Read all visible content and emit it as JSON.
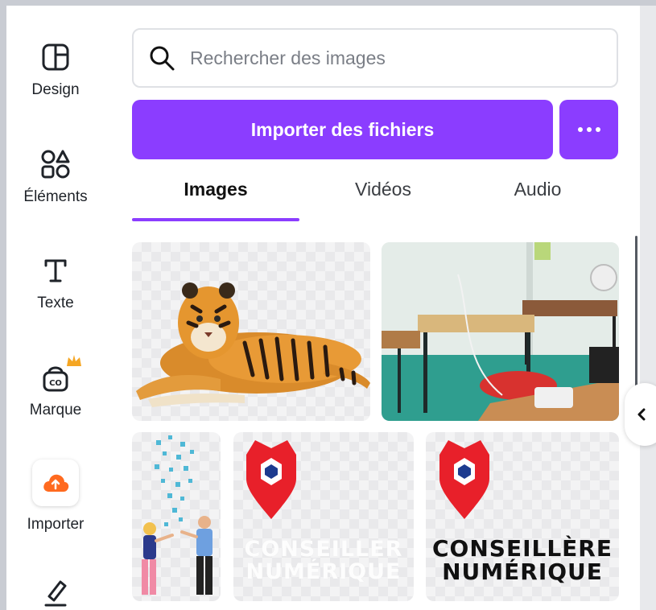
{
  "rail": {
    "items": [
      {
        "label": "Design"
      },
      {
        "label": "Éléments"
      },
      {
        "label": "Texte"
      },
      {
        "label": "Marque"
      },
      {
        "label": "Importer"
      }
    ]
  },
  "search": {
    "placeholder": "Rechercher des images"
  },
  "upload": {
    "label": "Importer des fichiers"
  },
  "tabs": [
    {
      "label": "Images",
      "active": true
    },
    {
      "label": "Vidéos"
    },
    {
      "label": "Audio"
    }
  ],
  "thumbnails": {
    "logo_transparent": {
      "line1": "CONSEILLER",
      "line2": "NUMÉRIQUE"
    },
    "logo_dark": {
      "line1": "CONSEILLÈRE",
      "line2": "NUMÉRIQUE"
    }
  },
  "colors": {
    "accent": "#8b3dff",
    "import_icon": "#ff6a1f",
    "crown": "#f5a623",
    "logo_red": "#e8202a",
    "logo_blue": "#1d3b8f"
  }
}
